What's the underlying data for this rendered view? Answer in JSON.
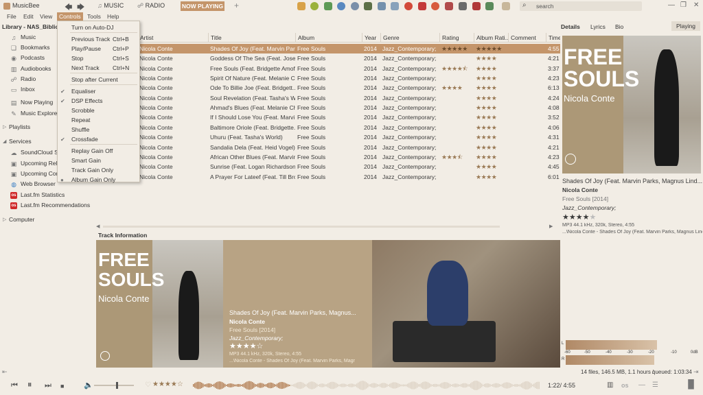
{
  "app": {
    "title": "MusicBee"
  },
  "colors": {
    "accent": "#c4956a",
    "bg": "#f2ede5",
    "star": "#9a7a55"
  },
  "menubar": [
    "File",
    "Edit",
    "View",
    "Controls",
    "Tools",
    "Help"
  ],
  "toolbar": {
    "music_label": "MUSIC",
    "radio_label": "RADIO",
    "nowplaying_label": "NOW PLAYING",
    "add_tab": "+",
    "search_placeholder": "search"
  },
  "leftpanel": {
    "library_header": "Library - NAS_Bibliot",
    "items": [
      {
        "label": "Music",
        "icon": "♫"
      },
      {
        "label": "Bookmarks",
        "icon": "❏"
      },
      {
        "label": "Podcasts",
        "icon": "◉"
      },
      {
        "label": "Audiobooks",
        "icon": "▥"
      },
      {
        "label": "Radio",
        "icon": "☍"
      },
      {
        "label": "Inbox",
        "icon": "▭"
      },
      {
        "label": "Now Playing",
        "icon": "▤"
      },
      {
        "label": "Music Explorer",
        "icon": "✎"
      }
    ],
    "playlists": "Playlists",
    "services": "Services",
    "service_items": [
      {
        "label": "SoundCloud Se",
        "icon": "☁"
      },
      {
        "label": "Upcoming Rel",
        "icon": "▣"
      },
      {
        "label": "Upcoming Cor",
        "icon": "▣"
      },
      {
        "label": "Web Browser",
        "icon": "◍"
      },
      {
        "label": "Last.fm Statistics",
        "icon": "os"
      },
      {
        "label": "Last.fm Recommendations",
        "icon": "os"
      }
    ],
    "computer": "Computer"
  },
  "dropdown": {
    "items": [
      {
        "label": "Turn on Auto-DJ",
        "shortcut": "",
        "checked": false
      },
      {
        "label": "Previous Track",
        "shortcut": "Ctrl+B",
        "checked": false
      },
      {
        "label": "Play/Pause",
        "shortcut": "Ctrl+P",
        "checked": false
      },
      {
        "label": "Stop",
        "shortcut": "Ctrl+S",
        "checked": false
      },
      {
        "label": "Next Track",
        "shortcut": "Ctrl+N",
        "checked": false
      },
      {
        "label": "Stop after Current",
        "shortcut": "",
        "checked": false
      },
      {
        "label": "Equaliser",
        "shortcut": "",
        "checked": true
      },
      {
        "label": "DSP Effects",
        "shortcut": "",
        "checked": true
      },
      {
        "label": "Scrobble",
        "shortcut": "",
        "checked": false
      },
      {
        "label": "Repeat",
        "shortcut": "",
        "checked": false
      },
      {
        "label": "Shuffle",
        "shortcut": "",
        "checked": false
      },
      {
        "label": "Crossfade",
        "shortcut": "",
        "checked": true
      },
      {
        "label": "Replay Gain Off",
        "shortcut": "",
        "checked": false
      },
      {
        "label": "Smart Gain",
        "shortcut": "",
        "checked": false
      },
      {
        "label": "Track Gain Only",
        "shortcut": "",
        "checked": false
      },
      {
        "label": "Album Gain Only",
        "shortcut": "",
        "checked": true
      }
    ]
  },
  "tracklist": {
    "columns": [
      "Artist",
      "Title",
      "Album",
      "Year",
      "Genre",
      "Rating",
      "Album Rati...",
      "Comment",
      "Time"
    ],
    "rows": [
      {
        "artist": "Nicola Conte",
        "title": "Shades Of Joy (Feat. Marvin Park...",
        "album": "Free Souls",
        "year": "2014",
        "genre": "Jazz_Contemporary;",
        "rating": 5,
        "album_rating": 5,
        "time": "4:55"
      },
      {
        "artist": "Nicola Conte",
        "title": "Goddess Of The Sea (Feat. Jose J...",
        "album": "Free Souls",
        "year": "2014",
        "genre": "Jazz_Contemporary;",
        "rating": 0,
        "album_rating": 4,
        "time": "4:21"
      },
      {
        "artist": "Nicola Conte",
        "title": "Free Souls (Feat. Bridgette Amof...",
        "album": "Free Souls",
        "year": "2014",
        "genre": "Jazz_Contemporary;",
        "rating": 4.5,
        "album_rating": 4,
        "time": "3:37"
      },
      {
        "artist": "Nicola Conte",
        "title": "Spirit Of Nature (Feat. Melanie C...",
        "album": "Free Souls",
        "year": "2014",
        "genre": "Jazz_Contemporary;",
        "rating": 0,
        "album_rating": 4,
        "time": "4:23"
      },
      {
        "artist": "Nicola Conte",
        "title": "Ode To Billie Joe (Feat. Bridgett...",
        "album": "Free Souls",
        "year": "2014",
        "genre": "Jazz_Contemporary;",
        "rating": 4,
        "album_rating": 4,
        "time": "6:13"
      },
      {
        "artist": "Nicola Conte",
        "title": "Soul Revelation (Feat. Tasha's W...",
        "album": "Free Souls",
        "year": "2014",
        "genre": "Jazz_Contemporary;",
        "rating": 0,
        "album_rating": 4,
        "time": "4:24"
      },
      {
        "artist": "Nicola Conte",
        "title": "Ahmad's Blues (Feat. Melanie Ch...",
        "album": "Free Souls",
        "year": "2014",
        "genre": "Jazz_Contemporary;",
        "rating": 0,
        "album_rating": 4,
        "time": "4:08"
      },
      {
        "artist": "Nicola Conte",
        "title": "If I Should Lose You (Feat. Marvi...",
        "album": "Free Souls",
        "year": "2014",
        "genre": "Jazz_Contemporary;",
        "rating": 0,
        "album_rating": 4,
        "time": "3:52"
      },
      {
        "artist": "Nicola Conte",
        "title": "Baltimore Oriole (Feat. Bridgette...",
        "album": "Free Souls",
        "year": "2014",
        "genre": "Jazz_Contemporary;",
        "rating": 0,
        "album_rating": 4,
        "time": "4:06"
      },
      {
        "artist": "Nicola Conte",
        "title": "Uhuru (Feat. Tasha's World)",
        "album": "Free Souls",
        "year": "2014",
        "genre": "Jazz_Contemporary;",
        "rating": 0,
        "album_rating": 4,
        "time": "4:31"
      },
      {
        "artist": "Nicola Conte",
        "title": "Sandalia Dela (Feat. Heid Vogel)",
        "album": "Free Souls",
        "year": "2014",
        "genre": "Jazz_Contemporary;",
        "rating": 0,
        "album_rating": 4,
        "time": "4:21"
      },
      {
        "artist": "Nicola Conte",
        "title": "African Other Blues (Feat. Marvin...",
        "album": "Free Souls",
        "year": "2014",
        "genre": "Jazz_Contemporary;",
        "rating": 3.5,
        "album_rating": 4,
        "time": "4:23"
      },
      {
        "artist": "Nicola Conte",
        "title": "Sunrise (Feat. Logan Richardson)",
        "album": "Free Souls",
        "year": "2014",
        "genre": "Jazz_Contemporary;",
        "rating": 0,
        "album_rating": 4,
        "time": "4:45"
      },
      {
        "artist": "Nicola Conte",
        "title": "A Prayer For Lateef (Feat. Till Bro...",
        "album": "Free Souls",
        "year": "2014",
        "genre": "Jazz_Contemporary;",
        "rating": 0,
        "album_rating": 4,
        "time": "6:01"
      }
    ]
  },
  "trackinfo": {
    "header": "Track Information",
    "title": "Shades Of Joy (Feat. Marvin Parks, Magnus...",
    "artist": "Nicola Conte",
    "album": "Free Souls [2014]",
    "genre": "Jazz_Contemporary;",
    "rating": 4,
    "tech": "MP3 44.1 kHz, 320k, Stereo, 4:55",
    "path": "...\\Nicola Conte - Shades Of Joy (Feat. Marvin Parks, Magr"
  },
  "cover": {
    "title_line1": "FREE",
    "title_line2": "SOULS",
    "artist": "Nicola Conte"
  },
  "rightpanel": {
    "tabs": [
      "Details",
      "Lyrics",
      "Bio"
    ],
    "playing": "Playing",
    "title": "Shades Of Joy (Feat. Marvin Parks, Magnus Lind...",
    "artist": "Nicola Conte",
    "album": "Free Souls [2014]",
    "genre": "Jazz_Contemporary;",
    "rating": 4,
    "tech": "MP3 44.1 kHz, 320k, Stereo, 4:55",
    "path": "...\\Nicola Conte - Shades Of Joy (Feat. Marvin Parks, Magnus Linc"
  },
  "meter": {
    "left_label": "L",
    "right_label": "R",
    "ticks": [
      "-60",
      "-50",
      "-40",
      "-30",
      "-20",
      "-10",
      "0dB"
    ],
    "left_level": 0.68,
    "right_level": 0.66
  },
  "statusbar": {
    "text": "14 files, 146.5 MB, 1.1 hours /",
    "queued": "queued: 1:03:34"
  },
  "player": {
    "time": "1:22/ 4:55",
    "rating": 4,
    "progress": 0.28,
    "volume": 0.55
  }
}
